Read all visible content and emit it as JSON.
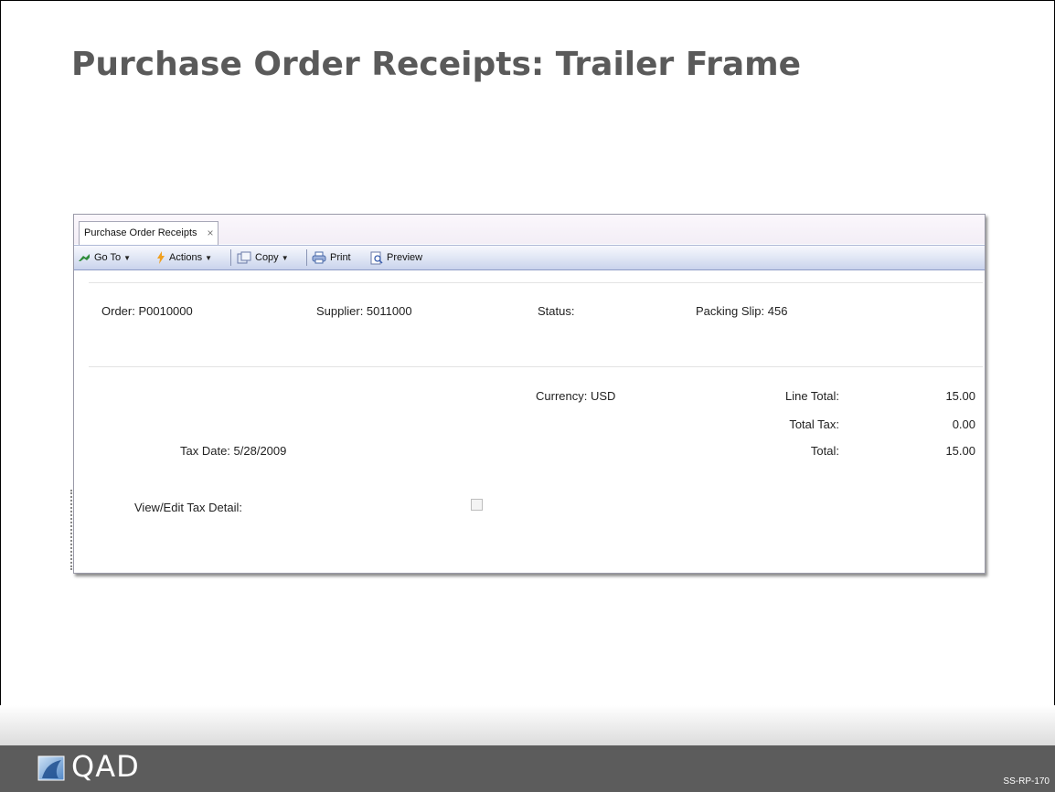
{
  "slide": {
    "title": "Purchase Order Receipts: Trailer Frame",
    "code": "SS-RP-170",
    "logo_text": "QAD"
  },
  "window": {
    "tab_label": "Purchase Order Receipts",
    "tab_close": "×"
  },
  "toolbar": {
    "goto_label": "Go To",
    "actions_label": "Actions",
    "copy_label": "Copy",
    "print_label": "Print",
    "preview_label": "Preview",
    "dropdown_caret": "▼"
  },
  "header_fields": {
    "order": "Order:  P0010000",
    "supplier": "Supplier:  5011000",
    "status": "Status:",
    "packing_slip": "Packing Slip:  456"
  },
  "trailer": {
    "currency": "Currency:  USD",
    "line_total_label": "Line Total:",
    "line_total_value": "15.00",
    "total_tax_label": "Total Tax:",
    "total_tax_value": "0.00",
    "tax_date": "Tax Date:  5/28/2009",
    "total_label": "Total:",
    "total_value": "15.00",
    "view_edit_tax_label": "View/Edit Tax Detail:",
    "view_edit_tax_checked": false
  },
  "colors": {
    "title_text": "#5a5a5a",
    "footer_bar": "#5c5c5c",
    "toolbar_blue": "#c9d3ec"
  }
}
